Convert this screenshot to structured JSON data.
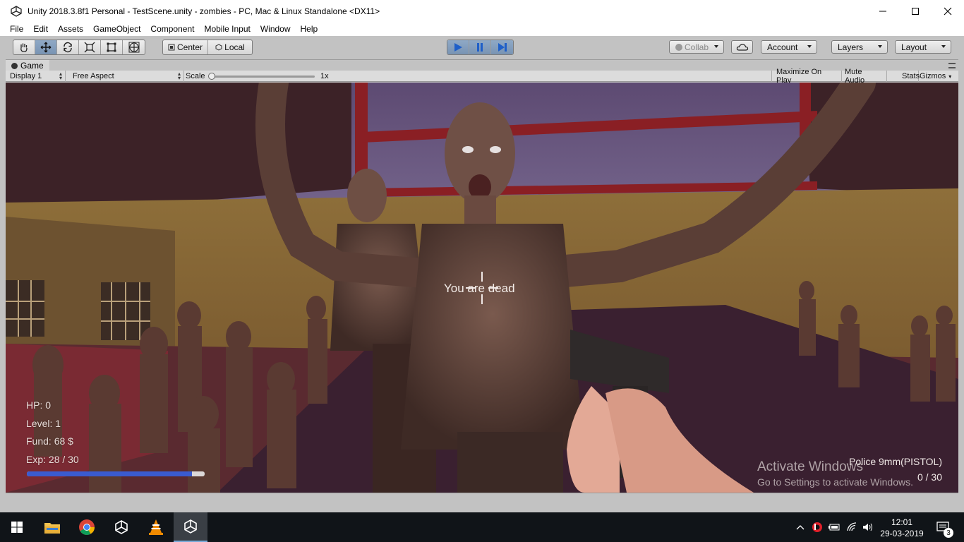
{
  "window": {
    "title": "Unity 2018.3.8f1 Personal - TestScene.unity - zombies - PC, Mac & Linux Standalone <DX11>",
    "minimize_icon": "minimize-icon",
    "maximize_icon": "maximize-icon",
    "close_icon": "close-icon"
  },
  "menu": [
    "File",
    "Edit",
    "Assets",
    "GameObject",
    "Component",
    "Mobile Input",
    "Window",
    "Help"
  ],
  "toolbar": {
    "tools": [
      "hand-icon",
      "move-icon",
      "rotate-icon",
      "scale-icon",
      "rect-icon",
      "transform-icon"
    ],
    "pivot": "Center",
    "space": "Local",
    "collab": "Collab",
    "account": "Account",
    "layers": "Layers",
    "layout": "Layout"
  },
  "game_tab": {
    "label": "Game"
  },
  "game_bar": {
    "display": "Display 1",
    "aspect": "Free Aspect",
    "scale_label": "Scale",
    "scale_value": "1x",
    "maximize": "Maximize On Play",
    "mute": "Mute Audio",
    "stats": "Stats",
    "gizmos": "Gizmos"
  },
  "hud": {
    "hp": "HP: 0",
    "level": "Level: 1",
    "fund": "Fund: 68 $",
    "exp": "Exp: 28 / 30",
    "exp_fraction": 0.93,
    "message": "You are dead",
    "weapon": "Police 9mm(PISTOL)",
    "ammo": "0 / 30"
  },
  "watermark": {
    "line1": "Activate Windows",
    "line2": "Go to Settings to activate Windows."
  },
  "taskbar": {
    "time": "12:01",
    "date": "29-03-2019",
    "notifications": "3"
  },
  "colors": {
    "play_active": "#2f74c8",
    "exp_fill": "#3a5bd0"
  }
}
